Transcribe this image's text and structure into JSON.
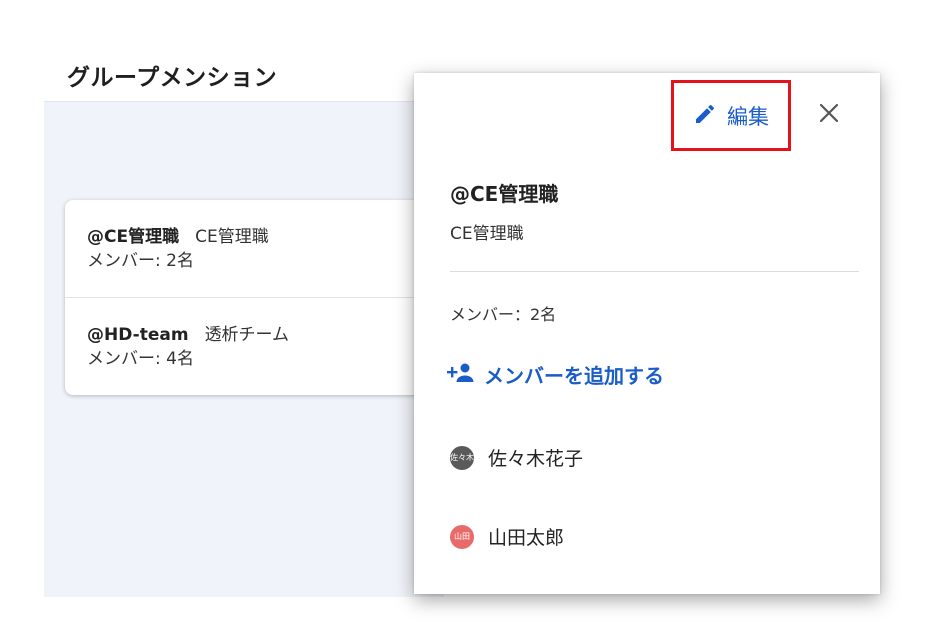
{
  "page": {
    "title": "グループメンション"
  },
  "groups": [
    {
      "handle": "@CE管理職",
      "name": "CE管理職",
      "members": "メンバー: 2名"
    },
    {
      "handle": "@HD-team",
      "name": "透析チーム",
      "members": "メンバー: 4名"
    }
  ],
  "panel": {
    "edit_label": "編集",
    "handle": "@CE管理職",
    "name": "CE管理職",
    "member_count": "メンバー：2名",
    "add_member_label": "メンバーを追加する",
    "members": [
      {
        "name": "佐々木花子",
        "avatar_text": "佐々木",
        "avatar_color": "#5a5a5a"
      },
      {
        "name": "山田太郎",
        "avatar_text": "山田",
        "avatar_color": "#e96a6a"
      }
    ]
  },
  "colors": {
    "accent": "#1a5cc8",
    "highlight_border": "#e5121c"
  },
  "icons": {
    "edit": "pencil-icon",
    "close": "close-icon",
    "add_member": "person-add-icon"
  }
}
